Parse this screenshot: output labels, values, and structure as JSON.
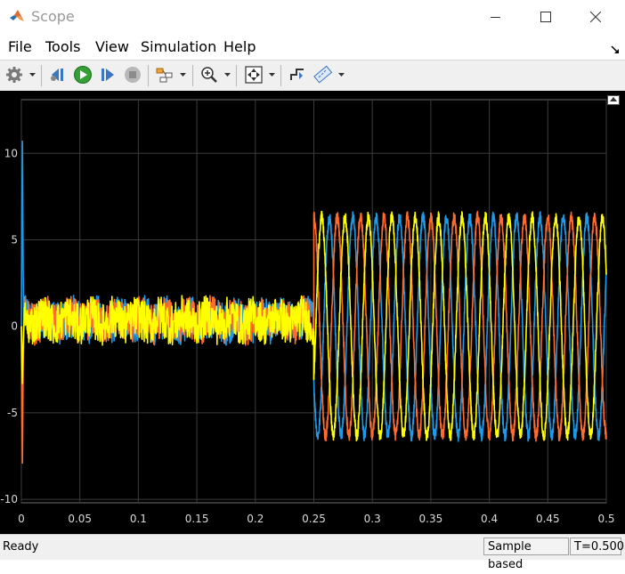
{
  "window": {
    "title": "Scope",
    "icon": "matlab-logo-icon",
    "controls": [
      "minimize-icon",
      "maximize-icon",
      "close-icon"
    ]
  },
  "menu": {
    "items": [
      "File",
      "Tools",
      "View",
      "Simulation",
      "Help"
    ]
  },
  "toolbar": {
    "buttons": [
      "settings-gear-icon",
      "step-back-icon",
      "run-icon",
      "step-forward-icon",
      "stop-icon",
      "signal-select-icon",
      "zoom-in-icon",
      "scale-axes-icon",
      "triggers-icon",
      "measurements-icon"
    ]
  },
  "colors": {
    "plot_bg": "#000000",
    "grid": "#3c3c3c",
    "axis_text": "#d9d9d9",
    "series_a": "#0072bd",
    "series_b": "#ff6c2e",
    "series_c": "#ffff00",
    "series_a_display": "#1e9be8"
  },
  "chart_data": {
    "type": "line",
    "title": "",
    "xlabel": "",
    "ylabel": "",
    "xlim": [
      0,
      0.5
    ],
    "ylim": [
      -10.2,
      13.1
    ],
    "x_ticks": [
      "0",
      "0.05",
      "0.1",
      "0.15",
      "0.2",
      "0.25",
      "0.3",
      "0.35",
      "0.4",
      "0.45",
      "0.5"
    ],
    "y_ticks": [
      "-10",
      "-5",
      "0",
      "5",
      "10"
    ],
    "grid": true,
    "legend": "none",
    "series": [
      {
        "color": "#1e9be8",
        "segments": [
          {
            "x_range": [
              0,
              0.25
            ],
            "description_values": {
              "noise_amplitude": 1.2
            }
          },
          {
            "x_range": [
              0.25,
              0.5
            ],
            "amplitude": 6.3,
            "frequency_hz": 50,
            "phase_deg": 120
          }
        ],
        "initial_spike": 10.7
      },
      {
        "color": "#ff6c2e",
        "segments": [
          {
            "x_range": [
              0,
              0.25
            ],
            "description_values": {
              "noise_amplitude": 1.2
            }
          },
          {
            "x_range": [
              0.25,
              0.5
            ],
            "amplitude": 6.3,
            "frequency_hz": 50,
            "phase_deg": 0
          }
        ],
        "initial_spike": -7.9
      },
      {
        "color": "#ffff00",
        "segments": [
          {
            "x_range": [
              0,
              0.25
            ],
            "description_values": {
              "noise_amplitude": 1.2
            }
          },
          {
            "x_range": [
              0.25,
              0.5
            ],
            "amplitude": 6.3,
            "frequency_hz": 50,
            "phase_deg": 240
          }
        ],
        "initial_spike": -3.3
      }
    ]
  },
  "status": {
    "left": "Ready",
    "mode": "Sample based",
    "time": "T=0.500"
  }
}
